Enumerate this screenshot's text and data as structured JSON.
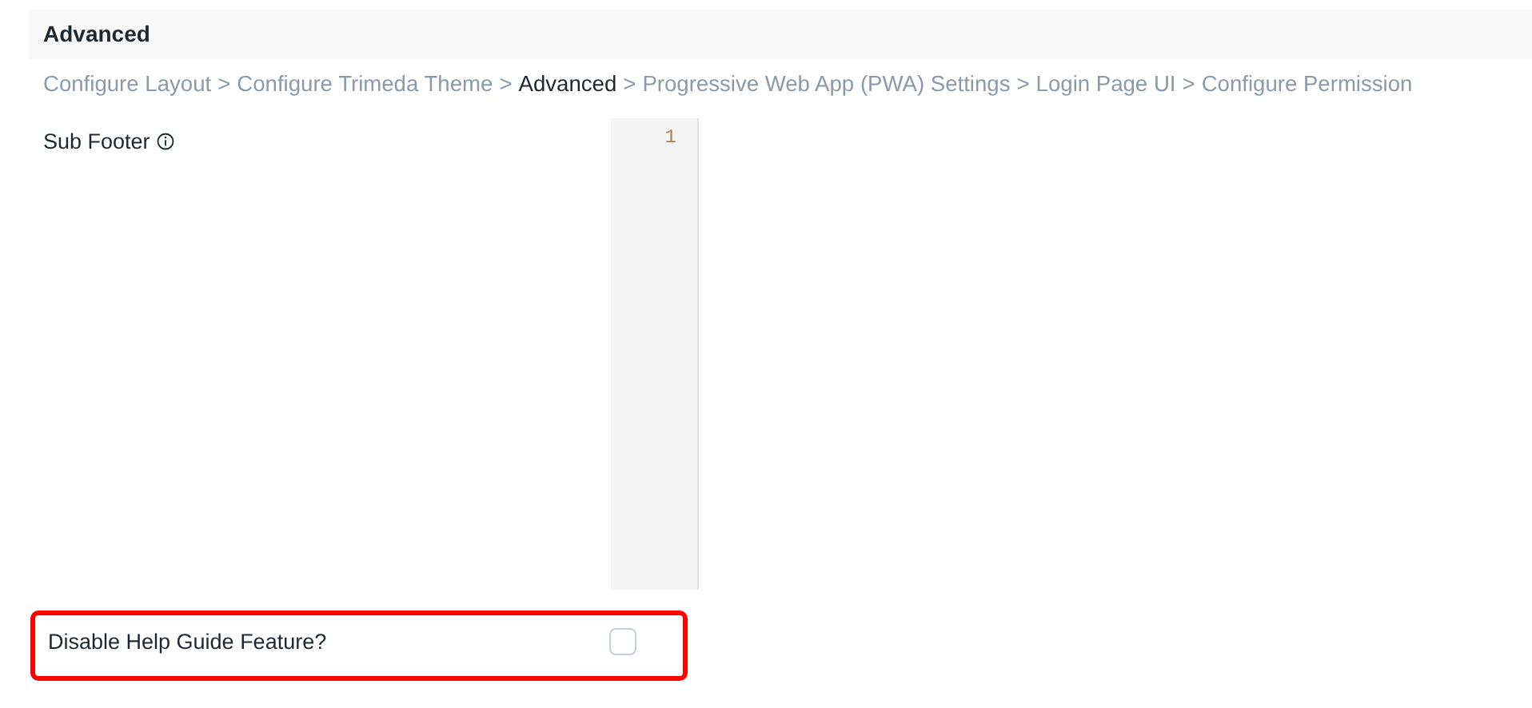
{
  "section": {
    "title": "Advanced"
  },
  "breadcrumb": {
    "items": [
      {
        "label": "Configure Layout",
        "selected": false
      },
      {
        "label": "Configure Trimeda Theme",
        "selected": false
      },
      {
        "label": "Advanced",
        "selected": true
      },
      {
        "label": "Progressive Web App (PWA) Settings",
        "selected": false
      },
      {
        "label": "Login Page UI",
        "selected": false
      },
      {
        "label": "Configure Permission",
        "selected": false
      }
    ],
    "separators": [
      ">",
      ">",
      ">",
      ">",
      ">"
    ]
  },
  "fields": [
    {
      "kind": "code",
      "label": "Sub Footer",
      "info": true,
      "line_numbers": [
        "1"
      ]
    },
    {
      "kind": "checkbox",
      "label": "Disable Help Guide Feature?",
      "checked": false,
      "highlighted": true
    }
  ]
}
